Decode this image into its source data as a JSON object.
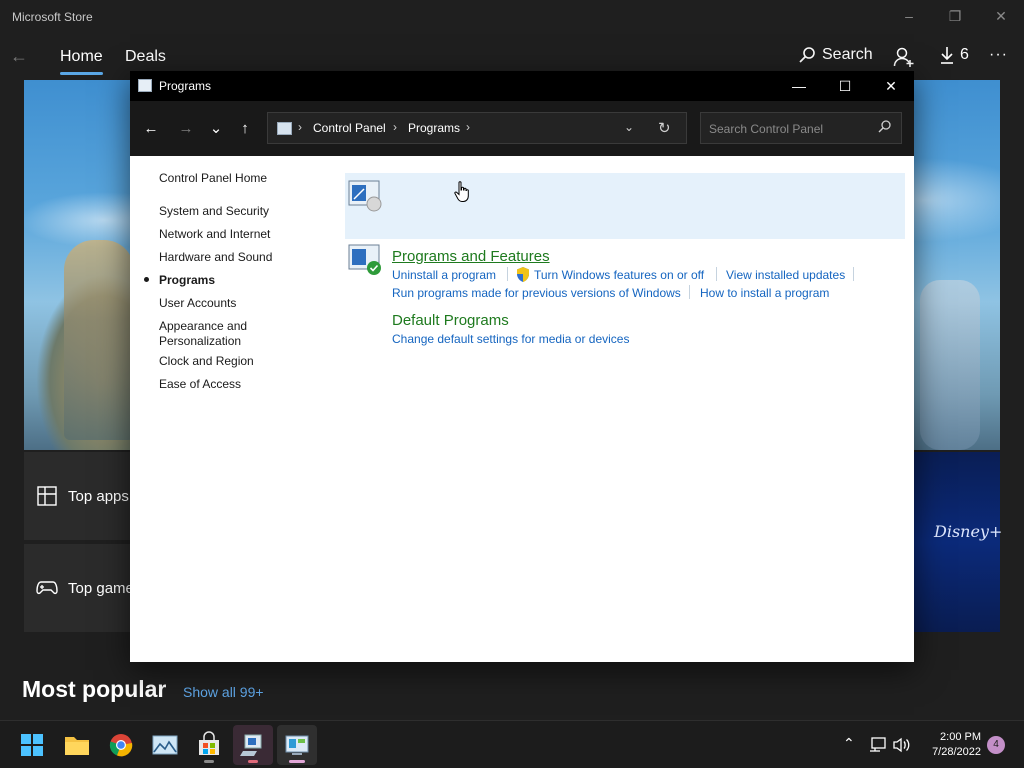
{
  "store": {
    "title": "Microsoft Store",
    "window_controls": {
      "minimize": "–",
      "restore": "❐",
      "close": "✕"
    },
    "back_glyph": "←",
    "tabs": [
      {
        "label": "Home",
        "active": true
      },
      {
        "label": "Deals",
        "active": false
      }
    ],
    "search_label": "Search",
    "downloads_count": "6",
    "more_glyph": "···",
    "tiles": [
      {
        "label": "Top apps",
        "icon": "grid-icon"
      },
      {
        "label": "Top games",
        "icon": "gamepad-icon"
      }
    ],
    "featured_brand": "Disney+",
    "section_title": "Most popular",
    "show_all": "Show all 99+"
  },
  "window": {
    "title": "Programs",
    "controls": {
      "minimize": "—",
      "maximize": "☐",
      "close": "✕"
    },
    "nav": {
      "back": "←",
      "forward": "→",
      "recent": "⌄",
      "up": "↑"
    },
    "breadcrumbs": [
      "Control Panel",
      "Programs"
    ],
    "breadcrumb_sep": "›",
    "refresh_glyph": "↻",
    "dropdown_glyph": "⌄",
    "search_placeholder": "Search Control Panel"
  },
  "sidebar": {
    "home": "Control Panel Home",
    "items": [
      {
        "label": "System and Security"
      },
      {
        "label": "Network and Internet"
      },
      {
        "label": "Hardware and Sound"
      },
      {
        "label": "Programs",
        "current": true
      },
      {
        "label": "User Accounts"
      },
      {
        "label": "Appearance and\nPersonalization"
      },
      {
        "label": "Clock and Region"
      },
      {
        "label": "Ease of Access"
      }
    ]
  },
  "categories": [
    {
      "title": "Programs and Features",
      "links_row1": [
        "Uninstall a program",
        "Turn Windows features on or off",
        "View installed updates"
      ],
      "links_row2": [
        "Run programs made for previous versions of Windows",
        "How to install a program"
      ]
    },
    {
      "title": "Default Programs",
      "links_row1": [
        "Change default settings for media or devices"
      ]
    }
  ],
  "taskbar": {
    "apps": [
      "start-icon",
      "file-explorer-icon",
      "chrome-icon",
      "photos-icon",
      "store-icon",
      "remote-app-icon",
      "control-panel-icon"
    ],
    "tray": {
      "chevron": "⌃",
      "network": "▭",
      "volume": "🔊"
    },
    "time": "2:00 PM",
    "date": "7/28/2022",
    "notification_count": "4"
  },
  "colors": {
    "accent": "#5aa7e6",
    "category_title": "#1e7a1e",
    "link": "#1565c0",
    "hover_bg": "#e5f1fb"
  }
}
